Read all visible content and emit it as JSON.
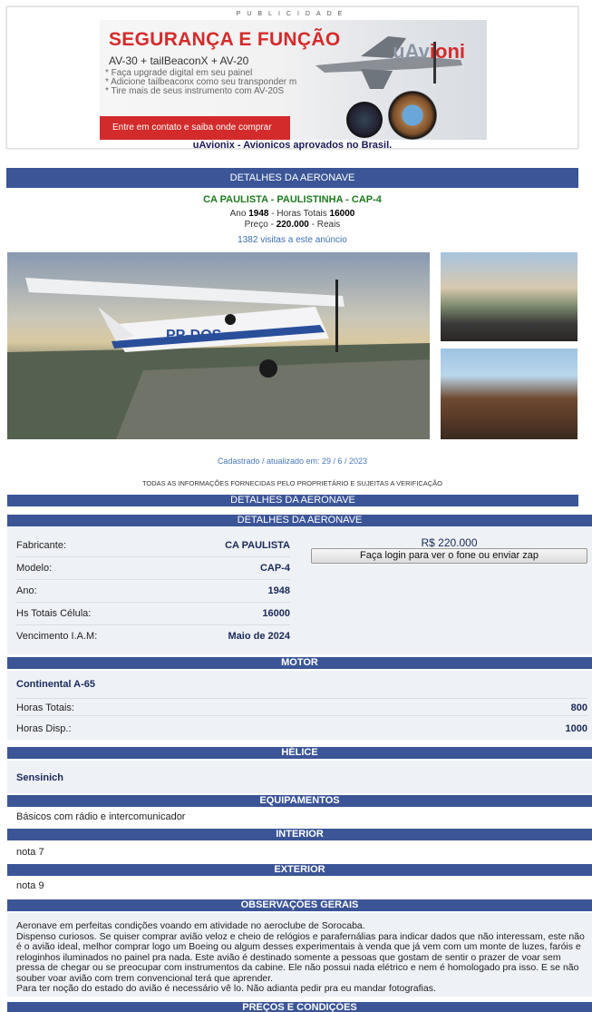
{
  "ad": {
    "label": "PUBLICIDADE",
    "title": "SEGURANÇA E FUNÇÃO",
    "subtitle": "AV-30 + tailBeaconX + AV-20",
    "bullets": [
      "* Faça upgrade digital em seu painel",
      "* Adicione tailbeaconx como seu transponder m",
      "* Tire mais de seus instrumento com AV-20S"
    ],
    "cta": "Entre em contato e saiba onde comprar",
    "brand_main": "uAv",
    "brand_accent": "ioni",
    "caption": "uAvionix - Avionicos aprovados no Brasil."
  },
  "header": {
    "section_title": "DETALHES DA AERONAVE",
    "aircraft_title": "CA PAULISTA - PAULISTINHA - CAP-4",
    "year_label": "Ano",
    "year": "1948",
    "hours_label": "Horas Totais",
    "hours": "16000",
    "price_label": "Preço",
    "price": "220.000",
    "currency": "Reais",
    "visits": "1382 visitas a este anúncio",
    "updated": "Cadastrado / atualizado em: 29 / 6 / 2023",
    "disclaimer": "TODAS AS INFORMAÇÕES FORNECIDAS PELO PROPRIETÁRIO E SUJEITAS A VERIFICAÇÃO",
    "plane_reg": "PP-DOS"
  },
  "details": {
    "bar1": "DETALHES DA AERONAVE",
    "bar2": "DETALHES DA AERONAVE",
    "rows": [
      {
        "k": "Fabricante:",
        "v": "CA PAULISTA"
      },
      {
        "k": "Modelo:",
        "v": "CAP-4"
      },
      {
        "k": "Ano:",
        "v": "1948"
      },
      {
        "k": "Hs Totais Célula:",
        "v": "16000"
      },
      {
        "k": "Vencimento I.A.M:",
        "v": "Maio de 2024"
      }
    ],
    "price": "R$ 220.000",
    "login_button": "Faça login para ver o fone ou enviar zap"
  },
  "motor": {
    "bar": "MOTOR",
    "name": "Continental A-65",
    "rows": [
      {
        "k": "Horas Totais:",
        "v": "800"
      },
      {
        "k": "Horas  Disp.:",
        "v": "1000"
      }
    ]
  },
  "helice": {
    "bar": "HÉLICE",
    "name": "Sensinich"
  },
  "equipamentos": {
    "bar": "EQUIPAMENTOS",
    "text": "Básicos com rádio e intercomunicador"
  },
  "interior": {
    "bar": "INTERIOR",
    "text": "nota 7"
  },
  "exterior": {
    "bar": "EXTERIOR",
    "text": "nota 9"
  },
  "observacoes": {
    "bar": "OBSERVAÇÕES GERAIS",
    "lines": [
      "Aeronave em perfeitas condições voando em atividade no aeroclube de Sorocaba.",
      "Dispenso curiosos. Se quiser comprar avião veloz e cheio de relógios e parafernálias para indicar dados que não interessam, este não é o avião ideal, melhor comprar logo um Boeing ou algum desses experimentais à venda que já vem com um monte de luzes, faróis e reloginhos iluminados no painel pra nada. Este avião é destinado somente a pessoas que gostam de sentir o prazer de voar sem pressa de chegar ou se preocupar com instrumentos da cabine. Ele não possui nada elétrico e nem é homologado pra isso. E se não souber voar avião com trem convencional terá que aprender.",
      "Para ter noção do estado do avião é necessário vê lo. Não adianta pedir pra eu mandar fotografias."
    ]
  },
  "precos": {
    "bar": "PREÇOS E CONDIÇÕES"
  },
  "colors": {
    "bar": "#3b5597",
    "accent_red": "#d52b2b",
    "title_green": "#1e7a1e"
  }
}
